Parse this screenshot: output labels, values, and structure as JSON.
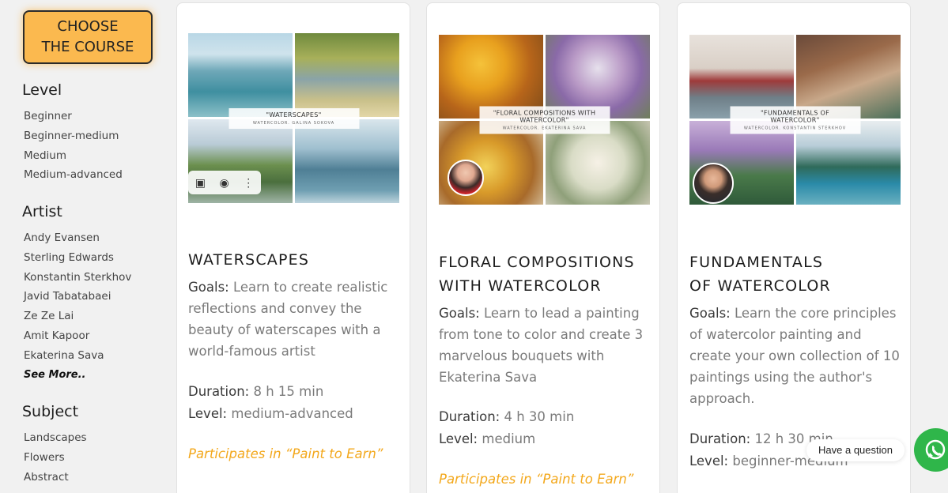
{
  "sidebar": {
    "choose_line1": "CHOOSE",
    "choose_line2": "THE COURSE",
    "level": {
      "title": "Level",
      "items": [
        "Beginner",
        "Beginner-medium",
        "Medium",
        "Medium-advanced"
      ]
    },
    "artist": {
      "title": "Artist",
      "items": [
        "Andy Evansen",
        "Sterling Edwards",
        "Konstantin Sterkhov",
        "Javid Tabatabaei",
        "Ze Ze Lai",
        "Amit Kapoor",
        "Ekaterina Sava"
      ],
      "see_more": "See More.."
    },
    "subject": {
      "title": "Subject",
      "items": [
        "Landscapes",
        "Flowers",
        "Abstract"
      ]
    }
  },
  "cards": [
    {
      "collage_title": "\"WATERSCAPES\"",
      "collage_sub": "WATERCOLOR. GALINA SOKOVA",
      "title_l1": "WATERSCAPES",
      "title_l2": "",
      "goals_label": "Goals:",
      "goals": "Learn to create realistic reflections and convey the beauty of waterscapes with a world-famous artist",
      "duration_label": "Duration:",
      "duration": "8 h 15 min",
      "level_label": "Level:",
      "level": "medium-advanced",
      "paint": "Participates in “Paint to Earn”"
    },
    {
      "collage_title": "\"FLORAL COMPOSITIONS WITH WATERCOLOR\"",
      "collage_sub": "WATERCOLOR. EKATERINA SAVA",
      "title_l1": "FLORAL COMPOSITIONS",
      "title_l2": "WITH WATERCOLOR",
      "goals_label": "Goals:",
      "goals": "Learn to lead a painting from tone to color and create 3 marvelous bouquets with Ekaterina Sava",
      "duration_label": "Duration:",
      "duration": "4 h 30 min",
      "level_label": "Level:",
      "level": "medium",
      "paint": "Participates in “Paint to Earn”"
    },
    {
      "collage_title": "\"FUNDAMENTALS OF WATERCOLOR\"",
      "collage_sub": "WATERCOLOR. KONSTANTIN STERKHOV",
      "title_l1": "FUNDAMENTALS",
      "title_l2": "OF WATERCOLOR",
      "goals_label": "Goals:",
      "goals": "Learn the core principles of watercolor painting and create your own collection of 10 paintings using the author's approach.",
      "duration_label": "Duration:",
      "duration": "12 h 30 min",
      "level_label": "Level:",
      "level": "beginner-medium",
      "paint": ""
    }
  ],
  "chat": {
    "question": "Have a question"
  },
  "icons": {
    "bookmark": "bookmark-icon",
    "lens": "lens-search-icon",
    "more": "more-vertical-icon",
    "whatsapp": "whatsapp-icon"
  },
  "colors": {
    "accent": "#fbb94f",
    "paint_link": "#f3a81c",
    "whatsapp": "#2fb64a"
  }
}
